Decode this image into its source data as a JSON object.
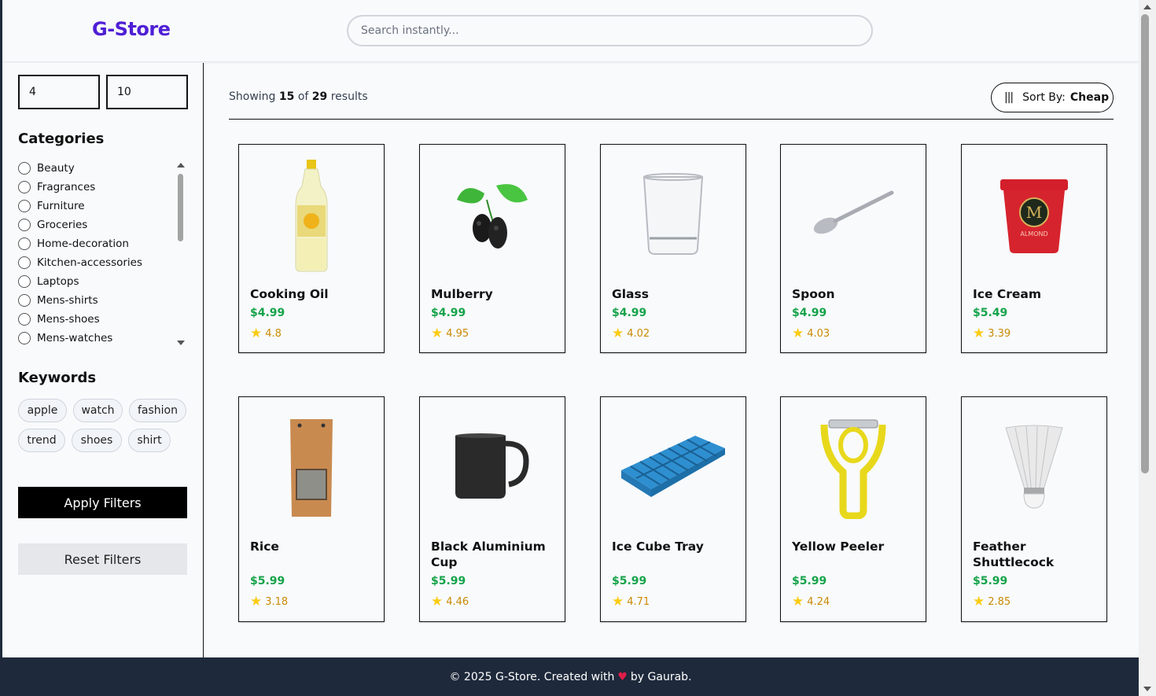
{
  "header": {
    "logo": "G-Store",
    "search_placeholder": "Search instantly..."
  },
  "filters": {
    "price_min": "4",
    "price_max": "10",
    "categories_title": "Categories",
    "categories": [
      "Beauty",
      "Fragrances",
      "Furniture",
      "Groceries",
      "Home-decoration",
      "Kitchen-accessories",
      "Laptops",
      "Mens-shirts",
      "Mens-shoes",
      "Mens-watches"
    ],
    "keywords_title": "Keywords",
    "keywords": [
      "apple",
      "watch",
      "fashion",
      "trend",
      "shoes",
      "shirt"
    ],
    "apply_label": "Apply Filters",
    "reset_label": "Reset Filters"
  },
  "results": {
    "prefix": "Showing",
    "shown": "15",
    "of": "of",
    "total": "29",
    "suffix": "results"
  },
  "sort": {
    "icon": "bars-icon",
    "label": "Sort By:",
    "value": "Cheap"
  },
  "products": [
    {
      "name": "Cooking Oil",
      "price": "$4.99",
      "rating": "4.8",
      "icon": "oil-bottle-icon"
    },
    {
      "name": "Mulberry",
      "price": "$4.99",
      "rating": "4.95",
      "icon": "mulberry-icon"
    },
    {
      "name": "Glass",
      "price": "$4.99",
      "rating": "4.02",
      "icon": "glass-icon"
    },
    {
      "name": "Spoon",
      "price": "$4.99",
      "rating": "4.03",
      "icon": "spoon-icon"
    },
    {
      "name": "Ice Cream",
      "price": "$5.49",
      "rating": "3.39",
      "icon": "ice-cream-tub-icon"
    },
    {
      "name": "Rice",
      "price": "$5.99",
      "rating": "3.18",
      "icon": "rice-bag-icon"
    },
    {
      "name": "Black Aluminium Cup",
      "price": "$5.99",
      "rating": "4.46",
      "icon": "mug-icon"
    },
    {
      "name": "Ice Cube Tray",
      "price": "$5.99",
      "rating": "4.71",
      "icon": "ice-tray-icon"
    },
    {
      "name": "Yellow Peeler",
      "price": "$5.99",
      "rating": "4.24",
      "icon": "peeler-icon"
    },
    {
      "name": "Feather Shuttlecock",
      "price": "$5.99",
      "rating": "2.85",
      "icon": "shuttlecock-icon"
    }
  ],
  "footer": {
    "before": "© 2025 G-Store. Created with",
    "after": "by Gaurab."
  },
  "colors": {
    "brand": "#4f1fd6",
    "price": "#16a34a",
    "rating": "#ca8a04",
    "footer_bg": "#1e293b"
  }
}
